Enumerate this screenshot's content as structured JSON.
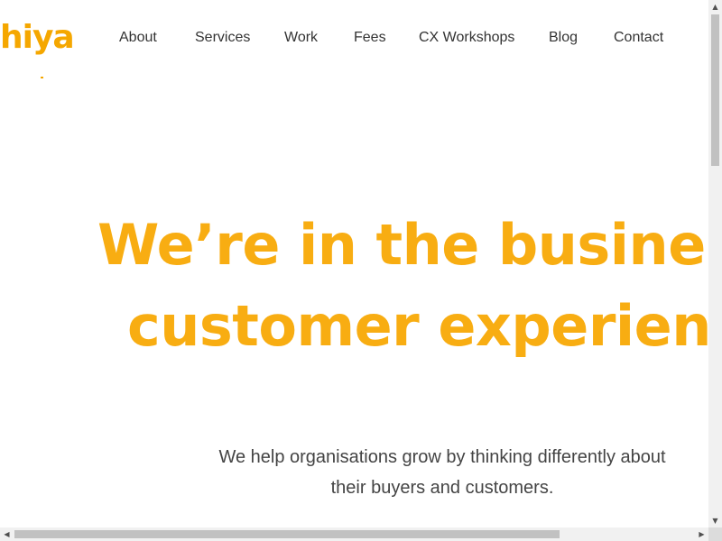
{
  "brand": {
    "logo_text": "hiya",
    "accent_color": "#f8ad12"
  },
  "nav": {
    "items": [
      {
        "label": "About"
      },
      {
        "label": "Services"
      },
      {
        "label": "Work"
      },
      {
        "label": "Fees"
      },
      {
        "label": "CX Workshops"
      },
      {
        "label": "Blog"
      },
      {
        "label": "Contact"
      }
    ]
  },
  "hero": {
    "line1": "We’re in the business",
    "line2": "customer experienc",
    "sub_line1": "We help organisations grow by thinking differently about",
    "sub_line2": "their buyers and customers."
  },
  "scrollbars": {
    "up_icon": "triangle-up",
    "down_icon": "triangle-down",
    "left_icon": "triangle-left",
    "right_icon": "triangle-right"
  }
}
